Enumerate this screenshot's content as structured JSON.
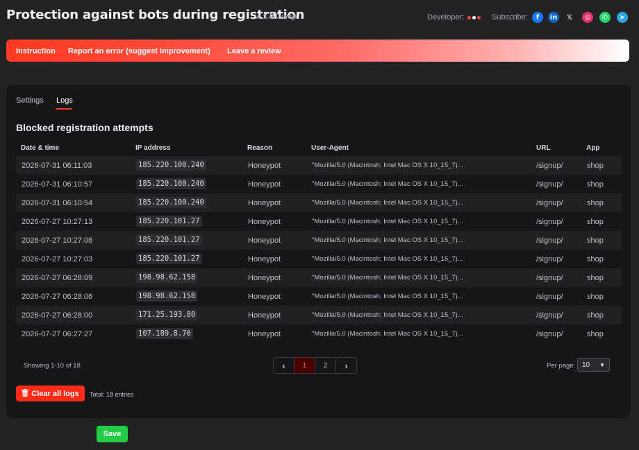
{
  "header": {
    "title": "Protection against bots during registration",
    "version": "v. 1.0.0.wsp",
    "developer_label": "Developer:",
    "subscribe_label": "Subscribe:",
    "dot_colors": [
      "#ff4040",
      "#ffffff",
      "#ff4040"
    ],
    "social": [
      {
        "icon": "facebook-icon",
        "glyph": "f",
        "color": "#1877f2"
      },
      {
        "icon": "linkedin-icon",
        "glyph": "in",
        "color": "#0a66c2"
      },
      {
        "icon": "x-icon",
        "glyph": "𝕏",
        "color": "#232325"
      },
      {
        "icon": "instagram-icon",
        "glyph": "◎",
        "color": "#e1306c"
      },
      {
        "icon": "whatsapp-icon",
        "glyph": "✆",
        "color": "#25d366"
      },
      {
        "icon": "telegram-icon",
        "glyph": "➤",
        "color": "#2aa3df"
      }
    ]
  },
  "banner": {
    "instruction": "Instruction",
    "report": "Report an error (suggest improvement)",
    "review": "Leave a review"
  },
  "tabs": {
    "settings": "Settings",
    "logs": "Logs"
  },
  "section_title": "Blocked registration attempts",
  "table": {
    "headers": {
      "date": "Date & time",
      "ip": "IP address",
      "reason": "Reason",
      "ua": "User-Agent",
      "url": "URL",
      "app": "App"
    },
    "rows": [
      {
        "date": "2026-07-31 06:11:03",
        "ip": "185.220.100.240",
        "reason": "Honeypot",
        "ua": "\"Mozilla/5.0 (Macintosh; Intel Mac OS X 10_15_7)...",
        "url": "/signup/",
        "app": "shop"
      },
      {
        "date": "2026-07-31 06:10:57",
        "ip": "185.220.100.240",
        "reason": "Honeypot",
        "ua": "\"Mozilla/5.0 (Macintosh; Intel Mac OS X 10_15_7)...",
        "url": "/signup/",
        "app": "shop"
      },
      {
        "date": "2026-07-31 06:10:54",
        "ip": "185.220.100.240",
        "reason": "Honeypot",
        "ua": "\"Mozilla/5.0 (Macintosh; Intel Mac OS X 10_15_7)...",
        "url": "/signup/",
        "app": "shop"
      },
      {
        "date": "2026-07-27 10:27:13",
        "ip": "185.220.101.27",
        "reason": "Honeypot",
        "ua": "\"Mozilla/5.0 (Macintosh; Intel Mac OS X 10_15_7)...",
        "url": "/signup/",
        "app": "shop"
      },
      {
        "date": "2026-07-27 10:27:08",
        "ip": "185.220.101.27",
        "reason": "Honeypot",
        "ua": "\"Mozilla/5.0 (Macintosh; Intel Mac OS X 10_15_7)...",
        "url": "/signup/",
        "app": "shop"
      },
      {
        "date": "2026-07-27 10:27:03",
        "ip": "185.220.101.27",
        "reason": "Honeypot",
        "ua": "\"Mozilla/5.0 (Macintosh; Intel Mac OS X 10_15_7)...",
        "url": "/signup/",
        "app": "shop"
      },
      {
        "date": "2026-07-27 06:28:09",
        "ip": "198.98.62.158",
        "reason": "Honeypot",
        "ua": "\"Mozilla/5.0 (Macintosh; Intel Mac OS X 10_15_7)...",
        "url": "/signup/",
        "app": "shop"
      },
      {
        "date": "2026-07-27 06:28:06",
        "ip": "198.98.62.158",
        "reason": "Honeypot",
        "ua": "\"Mozilla/5.0 (Macintosh; Intel Mac OS X 10_15_7)...",
        "url": "/signup/",
        "app": "shop"
      },
      {
        "date": "2026-07-27 06:28:00",
        "ip": "171.25.193.80",
        "reason": "Honeypot",
        "ua": "\"Mozilla/5.0 (Macintosh; Intel Mac OS X 10_15_7)...",
        "url": "/signup/",
        "app": "shop"
      },
      {
        "date": "2026-07-27 06:27:27",
        "ip": "107.189.8.70",
        "reason": "Honeypot",
        "ua": "\"Mozilla/5.0 (Macintosh; Intel Mac OS X 10_15_7)...",
        "url": "/signup/",
        "app": "shop"
      }
    ]
  },
  "footer": {
    "showing": "Showing 1-10 of 18",
    "pages": [
      "1",
      "2"
    ],
    "per_page_label": "Per page:",
    "per_page_value": "10",
    "clear_label": "Clear all logs",
    "total": "Total: 18 entries",
    "save_label": "Save"
  },
  "colors": {
    "accent": "#ff3b2a",
    "save": "#22cc44"
  }
}
